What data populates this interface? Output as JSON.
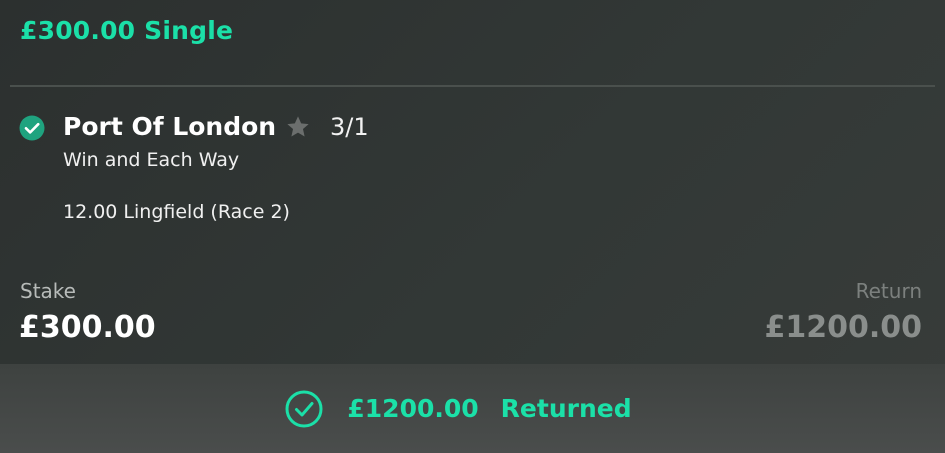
{
  "bet": {
    "header": "£300.00 Single"
  },
  "selection": {
    "icon": "check-circle-icon",
    "name": "Port Of London",
    "favourite_icon": "star-icon",
    "odds": "3/1",
    "market": "Win and Each Way",
    "event": "12.00 Lingfield (Race 2)"
  },
  "stake": {
    "label": "Stake",
    "value": "£300.00"
  },
  "returns": {
    "label": "Return",
    "value": "£1200.00"
  },
  "footer": {
    "icon": "check-circle-outline-icon",
    "amount": "£1200.00",
    "status": "Returned"
  },
  "colors": {
    "accent": "#1be0a8",
    "background": "#323836",
    "check_fill": "#1fa37f"
  }
}
